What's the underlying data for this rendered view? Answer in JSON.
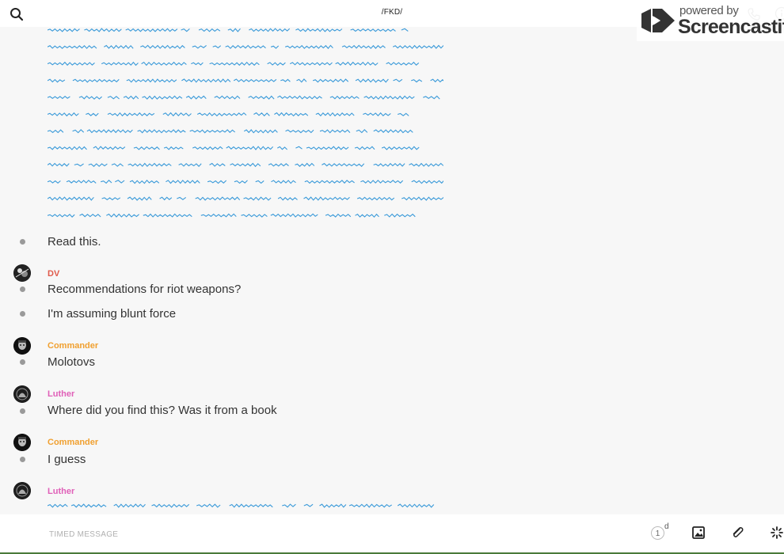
{
  "header": {
    "room_title": "/FKD/",
    "icons": [
      "search-icon",
      "phone-icon",
      "info-icon"
    ]
  },
  "watermark": {
    "powered_by": "powered by",
    "brand": "Screencastify"
  },
  "messages": [
    {
      "type": "attachment",
      "content": "illegible handwritten text image"
    },
    {
      "type": "text",
      "text": "Read this."
    },
    {
      "type": "text",
      "author": "DV",
      "author_color": "#e05a4b",
      "text": "Recommendations for riot weapons?"
    },
    {
      "type": "text",
      "text": "I'm assuming blunt force"
    },
    {
      "type": "text",
      "author": "Commander",
      "author_color": "#f0a030",
      "text": "Molotovs"
    },
    {
      "type": "text",
      "author": "Luther",
      "author_color": "#e060b8",
      "text": "Where did you find this? Was it from a book"
    },
    {
      "type": "text",
      "author": "Commander",
      "author_color": "#f0a030",
      "text": "I guess"
    },
    {
      "type": "attachment",
      "author": "Luther",
      "author_color": "#e060b8",
      "content": "illegible handwritten text image"
    }
  ],
  "composer": {
    "placeholder": "TIMED MESSAGE",
    "timer_value": "1",
    "timer_unit": "d",
    "icons": [
      "image-icon",
      "paperclip-icon",
      "sparkle-icon"
    ]
  },
  "colors": {
    "scribble": "#3a9ad9",
    "dot": "#9a9a9a",
    "accent_bar": "#4a7a3a"
  }
}
